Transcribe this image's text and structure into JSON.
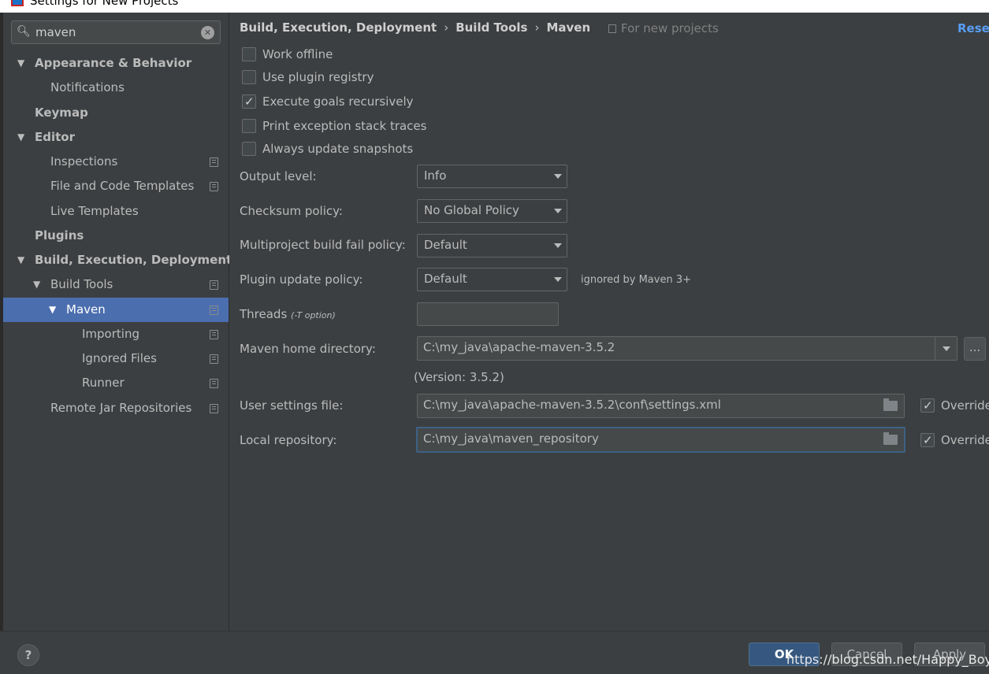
{
  "window": {
    "title": "Settings for New Projects"
  },
  "search": {
    "value": "maven",
    "icon": "search-icon",
    "clear_icon": "clear-icon"
  },
  "tree": [
    {
      "label": "Appearance & Behavior",
      "expanded": true,
      "bold": true
    },
    {
      "label": "Notifications"
    },
    {
      "label": "Keymap",
      "bold": true
    },
    {
      "label": "Editor",
      "expanded": true,
      "bold": true
    },
    {
      "label": "Inspections"
    },
    {
      "label": "File and Code Templates"
    },
    {
      "label": "Live Templates"
    },
    {
      "label": "Plugins",
      "bold": true
    },
    {
      "label": "Build, Execution, Deployment",
      "expanded": true,
      "bold": true
    },
    {
      "label": "Build Tools",
      "expanded": true
    },
    {
      "label": "Maven",
      "expanded": true,
      "selected": true
    },
    {
      "label": "Importing"
    },
    {
      "label": "Ignored Files"
    },
    {
      "label": "Runner"
    },
    {
      "label": "Remote Jar Repositories"
    }
  ],
  "breadcrumb": {
    "parts": [
      "Build, Execution, Deployment",
      "Build Tools",
      "Maven"
    ],
    "separator": "›"
  },
  "scope_note": "For new projects",
  "reset_label": "Reset",
  "checkboxes": [
    {
      "label": "Work offline",
      "checked": false
    },
    {
      "label": "Use plugin registry",
      "checked": false
    },
    {
      "label": "Execute goals recursively",
      "checked": true
    },
    {
      "label": "Print exception stack traces",
      "checked": false
    },
    {
      "label": "Always update snapshots",
      "checked": false
    }
  ],
  "fields": {
    "output_level": {
      "label": "Output level:",
      "value": "Info"
    },
    "checksum_policy": {
      "label": "Checksum policy:",
      "value": "No Global Policy"
    },
    "fail_policy": {
      "label": "Multiproject build fail policy:",
      "value": "Default"
    },
    "plugin_update_policy": {
      "label": "Plugin update policy:",
      "value": "Default",
      "note": "ignored by Maven 3+"
    },
    "threads": {
      "label": "Threads",
      "hint": "(-T option)",
      "value": ""
    },
    "maven_home": {
      "label": "Maven home directory:",
      "value": "C:\\my_java\\apache-maven-3.5.2",
      "version": "(Version: 3.5.2)",
      "browse_label": "..."
    },
    "user_settings": {
      "label": "User settings file:",
      "value": "C:\\my_java\\apache-maven-3.5.2\\conf\\settings.xml",
      "override_label": "Override",
      "override_checked": true
    },
    "local_repo": {
      "label": "Local repository:",
      "value": "C:\\my_java\\maven_repository",
      "override_label": "Override",
      "override_checked": true
    }
  },
  "buttons": {
    "help": "?",
    "ok": "OK",
    "cancel": "Cancel",
    "apply": "Apply"
  },
  "watermark": "https://blog.csdn.net/Happy_Boy_z",
  "colors": {
    "background": "#3c3f41",
    "selection": "#4b6eaf",
    "link": "#589df6",
    "ok_button": "#365880"
  }
}
